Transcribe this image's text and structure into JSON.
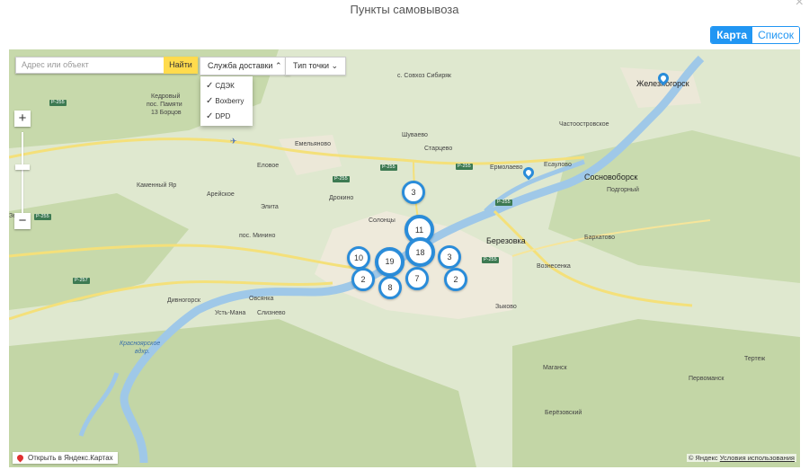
{
  "header": {
    "title": "Пункты самовывоза",
    "close": "×"
  },
  "view_toggle": {
    "map": "Карта",
    "list": "Список"
  },
  "search": {
    "placeholder": "Адрес или объект",
    "button": "Найти"
  },
  "filters": {
    "delivery": "Служба доставки",
    "point_type": "Тип точки",
    "options": [
      "СДЭК",
      "Boxberry",
      "DPD"
    ]
  },
  "clusters": [
    "3",
    "11",
    "18",
    "10",
    "19",
    "3",
    "2",
    "8",
    "7",
    "2"
  ],
  "places": {
    "zheleznogorsk": "Железногорск",
    "sovhoz": "с. Совхоз Сибиряк",
    "kedroviy": "Кедровый",
    "pos_pamyati": "пос. Памяти",
    "borcov": "13 Борцов",
    "emelyanovo": "Емельяново",
    "shuvaevo": "Шуваево",
    "chastoostrovskoe": "Частоостровское",
    "starcevo": "Старцево",
    "esaulovo": "Есаулово",
    "ermolaevo": "Ермолаево",
    "sosnovoborsk": "Сосновоборск",
    "podgorny": "Подгорный",
    "eloevoe": "Еловое",
    "kamenny_yar": "Каменный Яр",
    "areiskoe": "Арейское",
    "drokino": "Дрокино",
    "elita": "Элита",
    "soloncy": "Солонцы",
    "berezovka": "Березовка",
    "minino": "пос. Минино",
    "barhatovo": "Бархатово",
    "voznesenka": "Вознесенка",
    "divnogorsk": "Дивногорск",
    "ovsyanka": "Овсянка",
    "ust_mana": "Усть-Мана",
    "sliznevo": "Слизнево",
    "zykovo": "Зыково",
    "reservoir1": "Красноярское",
    "reservoir2": "вдхр.",
    "tertezh": "Тертеж",
    "pervomansk": "Первоманск",
    "magansk": "Маганск",
    "berezovsky": "Берёзовский",
    "ze_edge": "Зе"
  },
  "roads": [
    "Р-255",
    "Р-255",
    "Р-255",
    "Р-255",
    "Р-255",
    "Р-255",
    "Р-255",
    "Р-257"
  ],
  "footer": {
    "open_yandex": "Открыть в Яндекс.Картах",
    "copyright": "© Яндекс",
    "terms": "Условия использования"
  },
  "colors": {
    "accent": "#2196f3",
    "cluster": "#2a8cd9",
    "search_button": "#ffdb4d",
    "river": "#9fc8e8"
  },
  "icons": {
    "check": "✓",
    "chevron_up": "⌃",
    "chevron_down": "⌄",
    "zoom_in": "+",
    "zoom_out": "−"
  }
}
